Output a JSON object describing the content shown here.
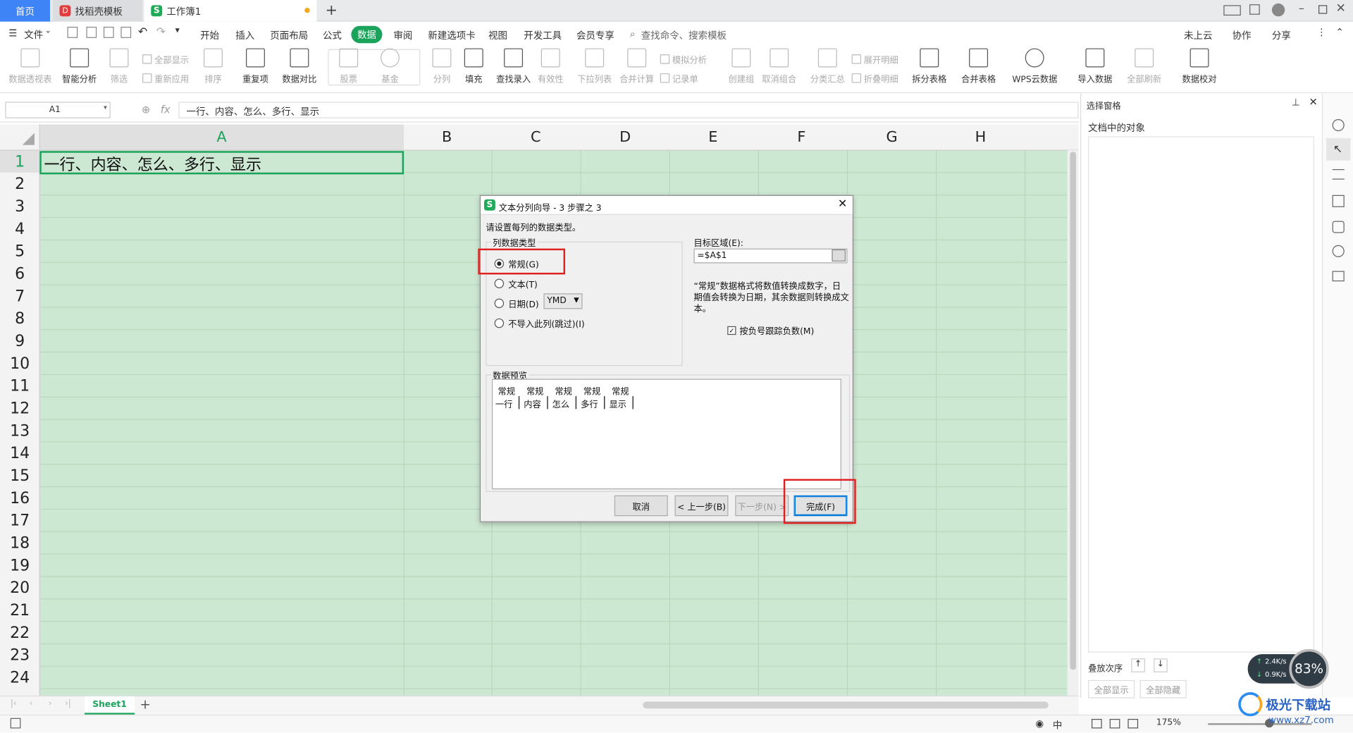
{
  "tabs": [
    {
      "label": "首页"
    },
    {
      "label": "找稻壳模板"
    },
    {
      "label": "工作簿1"
    }
  ],
  "menu": {
    "file": "文件",
    "items": [
      "开始",
      "插入",
      "页面布局",
      "公式",
      "数据",
      "审阅",
      "新建选项卡",
      "视图",
      "开发工具",
      "会员专享"
    ],
    "active": "数据",
    "search_placeholder": "查找命令、搜索模板",
    "right": [
      "未上云",
      "协作",
      "分享"
    ]
  },
  "ribbon": {
    "buttons": [
      "数据透视表",
      "智能分析",
      "筛选",
      "排序",
      "重复项",
      "数据对比",
      "股票",
      "基金",
      "分列",
      "填充",
      "查找录入",
      "有效性",
      "下拉列表",
      "合并计算",
      "创建组",
      "取消组合",
      "分类汇总",
      "拆分表格",
      "合并表格",
      "WPS云数据",
      "导入数据",
      "全部刷新",
      "数据校对"
    ],
    "small": [
      "全部显示",
      "重新应用",
      "模拟分析",
      "记录单",
      "展开明细",
      "折叠明细"
    ]
  },
  "formula_bar": {
    "cell_ref": "A1",
    "fx": "fx",
    "content": "一行、内容、怎么、多行、显示"
  },
  "sheet": {
    "columns": [
      "A",
      "B",
      "C",
      "D",
      "E",
      "F",
      "G",
      "H"
    ],
    "rows": [
      "1",
      "2",
      "3",
      "4",
      "5",
      "6",
      "7",
      "8",
      "9",
      "10",
      "11",
      "12",
      "13",
      "14",
      "15",
      "16",
      "17",
      "18",
      "19",
      "20",
      "21",
      "22",
      "23",
      "24"
    ],
    "cell_a1": "一行、内容、怎么、多行、显示"
  },
  "dialog": {
    "title": "文本分列向导 - 3 步骤之 3",
    "instruction": "请设置每列的数据类型。",
    "group_label": "列数据类型",
    "options": [
      "常规(G)",
      "文本(T)",
      "日期(D)",
      "不导入此列(跳过)(I)"
    ],
    "date_format": "YMD",
    "target_label": "目标区域(E):",
    "target_value": "=$A$1",
    "description": "“常规”数据格式将数值转换成数字，日期值会转换为日期，其余数据则转换成文本。",
    "checkbox_label": "按负号跟踪负数(M)",
    "preview_label": "数据预览",
    "preview_headers": [
      "常规",
      "常规",
      "常规",
      "常规",
      "常规"
    ],
    "preview_values": [
      "一行",
      "内容",
      "怎么",
      "多行",
      "显示"
    ],
    "buttons": {
      "cancel": "取消",
      "back": "< 上一步(B)",
      "next": "下一步(N) >",
      "finish": "完成(F)"
    }
  },
  "right_panel": {
    "title": "选择窗格",
    "heading": "文档中的对象",
    "order_label": "叠放次序",
    "show_all": "全部显示",
    "hide_all": "全部隐藏"
  },
  "sheet_tab": "Sheet1",
  "status": {
    "zoom": "175%",
    "lang": "中",
    "net_up": "2.4K/s",
    "net_down": "0.9K/s",
    "net_pct": "83%"
  },
  "watermark": "极光下载站",
  "watermark_url": "www.xz7.com"
}
